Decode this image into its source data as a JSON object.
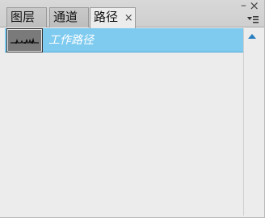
{
  "tabs": [
    {
      "label": "图层"
    },
    {
      "label": "通道"
    },
    {
      "label": "路径",
      "close": "×",
      "active": true
    }
  ],
  "window": {
    "close": "×",
    "minimize": "–",
    "menu_icon": "panel-menu-icon"
  },
  "paths": [
    {
      "name": "工作路径",
      "selected": true,
      "thumbnail": "path-thumbnail-icon"
    }
  ],
  "colors": {
    "selection": "#7fcbef",
    "panel_bg": "#ececec",
    "tab_bg": "#c3c3c3"
  }
}
